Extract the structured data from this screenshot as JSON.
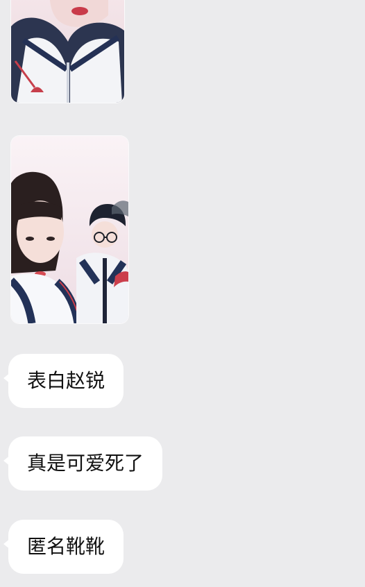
{
  "chat": {
    "photos": [
      {
        "name": "selfie-top",
        "icon": "photo-thumbnail"
      },
      {
        "name": "selfie-bottom",
        "icon": "photo-thumbnail"
      }
    ],
    "messages": [
      {
        "text": "表白赵锐"
      },
      {
        "text": "真是可爱死了"
      },
      {
        "text": "匿名靴靴"
      }
    ]
  },
  "colors": {
    "background": "#ebebed",
    "bubble": "#ffffff",
    "text": "#111111"
  }
}
